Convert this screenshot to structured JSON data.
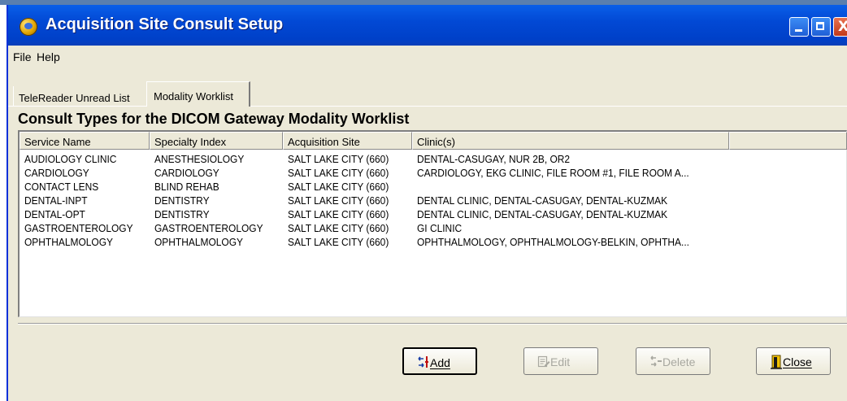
{
  "window": {
    "title": "Acquisition Site Consult Setup"
  },
  "menu": {
    "file": "File",
    "help": "Help"
  },
  "tabs": [
    {
      "label": "TeleReader Unread List",
      "active": false
    },
    {
      "label": "Modality Worklist",
      "active": true
    }
  ],
  "section_title": "Consult Types for the DICOM Gateway Modality Worklist",
  "columns": [
    "Service Name",
    "Specialty Index",
    "Acquisition Site",
    "Clinic(s)",
    ""
  ],
  "rows": [
    [
      "AUDIOLOGY CLINIC",
      "ANESTHESIOLOGY",
      "SALT LAKE CITY (660)",
      "DENTAL-CASUGAY, NUR 2B, OR2"
    ],
    [
      "CARDIOLOGY",
      "CARDIOLOGY",
      "SALT LAKE CITY (660)",
      "CARDIOLOGY, EKG CLINIC, FILE ROOM #1, FILE ROOM A..."
    ],
    [
      "CONTACT LENS",
      "BLIND REHAB",
      "SALT LAKE CITY (660)",
      ""
    ],
    [
      "DENTAL-INPT",
      "DENTISTRY",
      "SALT LAKE CITY (660)",
      "DENTAL CLINIC, DENTAL-CASUGAY, DENTAL-KUZMAK"
    ],
    [
      "DENTAL-OPT",
      "DENTISTRY",
      "SALT LAKE CITY (660)",
      "DENTAL CLINIC, DENTAL-CASUGAY, DENTAL-KUZMAK"
    ],
    [
      "GASTROENTEROLOGY",
      "GASTROENTEROLOGY",
      "SALT LAKE CITY (660)",
      "GI CLINIC"
    ],
    [
      "OPHTHALMOLOGY",
      "OPHTHALMOLOGY",
      "SALT LAKE CITY (660)",
      "OPHTHALMOLOGY, OPHTHALMOLOGY-BELKIN, OPHTHA..."
    ]
  ],
  "buttons": {
    "add": {
      "label": "Add",
      "enabled": true,
      "icon": "add-icon"
    },
    "edit": {
      "label": "Edit",
      "enabled": false,
      "icon": "edit-icon"
    },
    "delete": {
      "label": "Delete",
      "enabled": false,
      "icon": "delete-icon"
    },
    "close": {
      "label": "Close",
      "enabled": true,
      "icon": "close-door-icon"
    }
  },
  "colors": {
    "titlebar": "#0249d5",
    "face": "#ece9d8"
  }
}
